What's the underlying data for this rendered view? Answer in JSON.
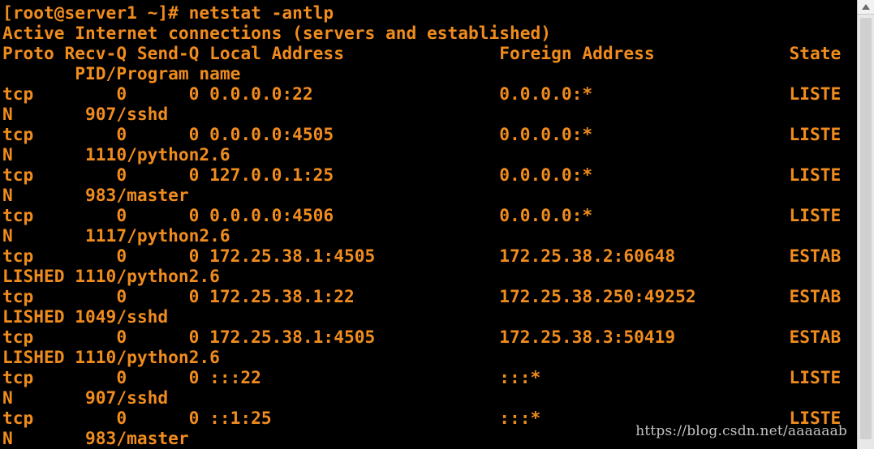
{
  "terminal": {
    "prompt": "[root@server1 ~]# ",
    "command": "netstat -antlp",
    "text_color": "#f08c1e",
    "background": "#000000",
    "lines": [
      "Active Internet connections (servers and established)",
      "Proto Recv-Q Send-Q Local Address               Foreign Address             State",
      "       PID/Program name",
      "tcp        0      0 0.0.0.0:22                  0.0.0.0:*                   LISTE",
      "N       907/sshd",
      "tcp        0      0 0.0.0.0:4505                0.0.0.0:*                   LISTE",
      "N       1110/python2.6",
      "tcp        0      0 127.0.0.1:25                0.0.0.0:*                   LISTE",
      "N       983/master",
      "tcp        0      0 0.0.0.0:4506                0.0.0.0:*                   LISTE",
      "N       1117/python2.6",
      "tcp        0      0 172.25.38.1:4505            172.25.38.2:60648           ESTAB",
      "LISHED 1110/python2.6",
      "tcp        0      0 172.25.38.1:22              172.25.38.250:49252         ESTAB",
      "LISHED 1049/sshd",
      "tcp        0      0 172.25.38.1:4505            172.25.38.3:50419           ESTAB",
      "LISHED 1110/python2.6",
      "tcp        0      0 :::22                       :::*                        LISTE",
      "N       907/sshd",
      "tcp        0      0 ::1:25                      :::*                        LISTE",
      "N       983/master"
    ]
  },
  "watermark": {
    "text": "https://blog.csdn.net/aaaaaab"
  },
  "scrollbar": {
    "up_icon": "triangle-up-icon"
  }
}
